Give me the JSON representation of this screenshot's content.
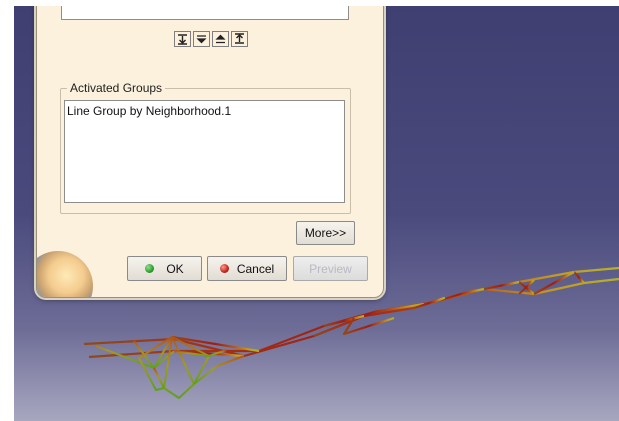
{
  "dialog": {
    "activated_groups_title": "Activated Groups",
    "activated_groups": [
      "Line Group by Neighborhood.1"
    ],
    "more_label": "More>>",
    "ok_label": "OK",
    "cancel_label": "Cancel",
    "preview_label": "Preview",
    "ok_dot_color": "#2e9e2e",
    "cancel_dot_color": "#c4241d"
  },
  "arrow_buttons": [
    {
      "name": "move-all-down-icon"
    },
    {
      "name": "move-down-icon"
    },
    {
      "name": "move-up-icon"
    },
    {
      "name": "move-all-up-icon"
    }
  ],
  "colors": {
    "viewport_top": "#3f3f72",
    "viewport_bottom": "#a8a7c0",
    "dialog_background": "#fbf1dd",
    "wireframe_red": "#9d1f14",
    "wireframe_green": "#5ea01e"
  }
}
